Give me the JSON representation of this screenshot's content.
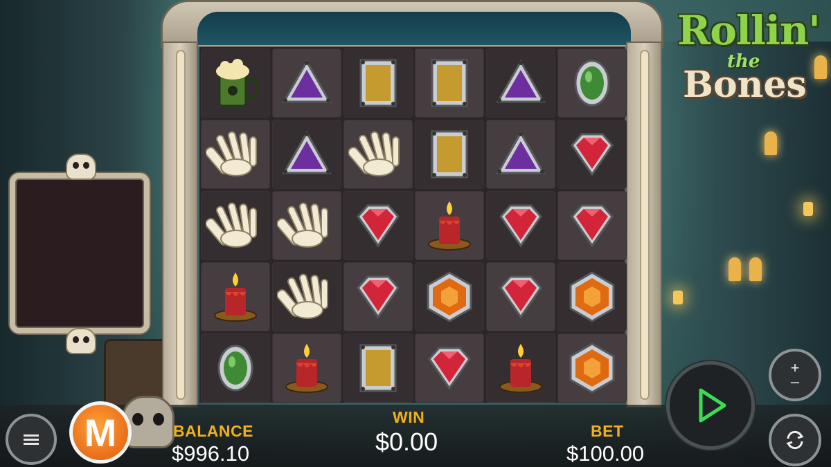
{
  "game": {
    "title_line1": "Rollin'",
    "title_line2": "the",
    "title_line3": "Bones"
  },
  "reels": {
    "columns": 6,
    "rows": 5,
    "symbols": [
      [
        "beer-mug",
        "purple-triangle",
        "gold-square",
        "gold-square",
        "purple-triangle",
        "green-oval"
      ],
      [
        "skeleton-hand",
        "purple-triangle",
        "skeleton-hand",
        "gold-square",
        "purple-triangle",
        "red-gem"
      ],
      [
        "skeleton-hand",
        "skeleton-hand",
        "red-gem",
        "candle",
        "red-gem",
        "red-gem"
      ],
      [
        "candle",
        "skeleton-hand",
        "red-gem",
        "orange-hexagon",
        "red-gem",
        "orange-hexagon"
      ],
      [
        "green-oval",
        "candle",
        "gold-square",
        "red-gem",
        "candle",
        "orange-hexagon"
      ]
    ]
  },
  "hud": {
    "balance_label": "BALANCE",
    "balance_value": "$996.10",
    "win_label": "WIN",
    "win_value": "$0.00",
    "bet_label": "BET",
    "bet_value": "$100.00"
  },
  "controls": {
    "menu_icon": "hamburger-icon",
    "brand_badge": "M",
    "spin_icon": "play-icon",
    "bet_plus": "+",
    "bet_minus": "–",
    "autoplay_icon": "refresh-icon"
  },
  "colors": {
    "hud_label": "#f0b020",
    "spin_accent": "#3ddc56",
    "brand_orange": "#f07a18"
  }
}
